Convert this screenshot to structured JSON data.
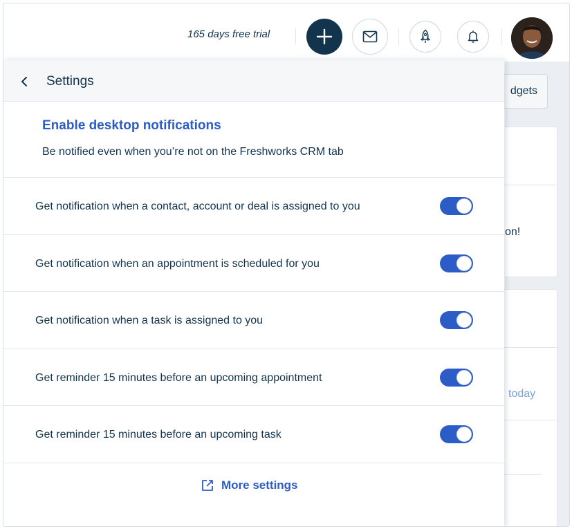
{
  "topbar": {
    "trial_text": "165 days free trial",
    "icons": [
      "plus-icon",
      "mail-icon",
      "rocket-icon",
      "bell-icon"
    ]
  },
  "background": {
    "widgets_label": "dgets",
    "partial_text_1": "on!",
    "partial_text_2": "today"
  },
  "panel": {
    "title": "Settings",
    "enable_link": "Enable desktop notifications",
    "enable_description": "Be notified even when you’re not on the Freshworks CRM tab",
    "rows": [
      {
        "label": "Get notification when a contact, account or deal is assigned to you",
        "enabled": true
      },
      {
        "label": "Get notification when an appointment is scheduled for you",
        "enabled": true
      },
      {
        "label": "Get notification when a task is assigned to you",
        "enabled": true
      },
      {
        "label": "Get reminder 15 minutes before an upcoming appointment",
        "enabled": true
      },
      {
        "label": "Get reminder 15 minutes before an upcoming task",
        "enabled": true
      }
    ],
    "more_settings": "More settings"
  },
  "colors": {
    "accent": "#2c5cc5",
    "dark": "#12344d",
    "toggle_on": "#2c5cc5"
  }
}
